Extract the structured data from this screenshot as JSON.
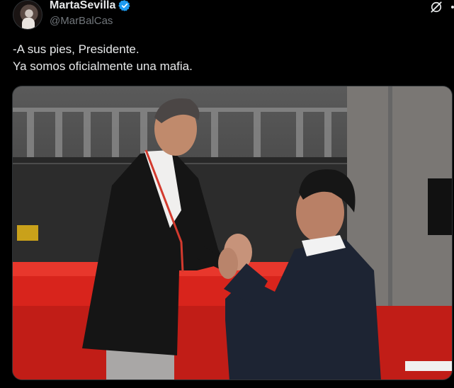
{
  "author": {
    "display_name": "MartaSevilla",
    "handle": "@MarBalCas",
    "verified": true,
    "verified_color": "#1d9bf0"
  },
  "header_icons": [
    "grok-icon",
    "more-icon"
  ],
  "tweet": {
    "lines": [
      "-A sus pies, Presidente.",
      "Ya somos oficialmente una mafia."
    ]
  },
  "media": {
    "kind": "photo",
    "stage_color": "#d8241c"
  }
}
